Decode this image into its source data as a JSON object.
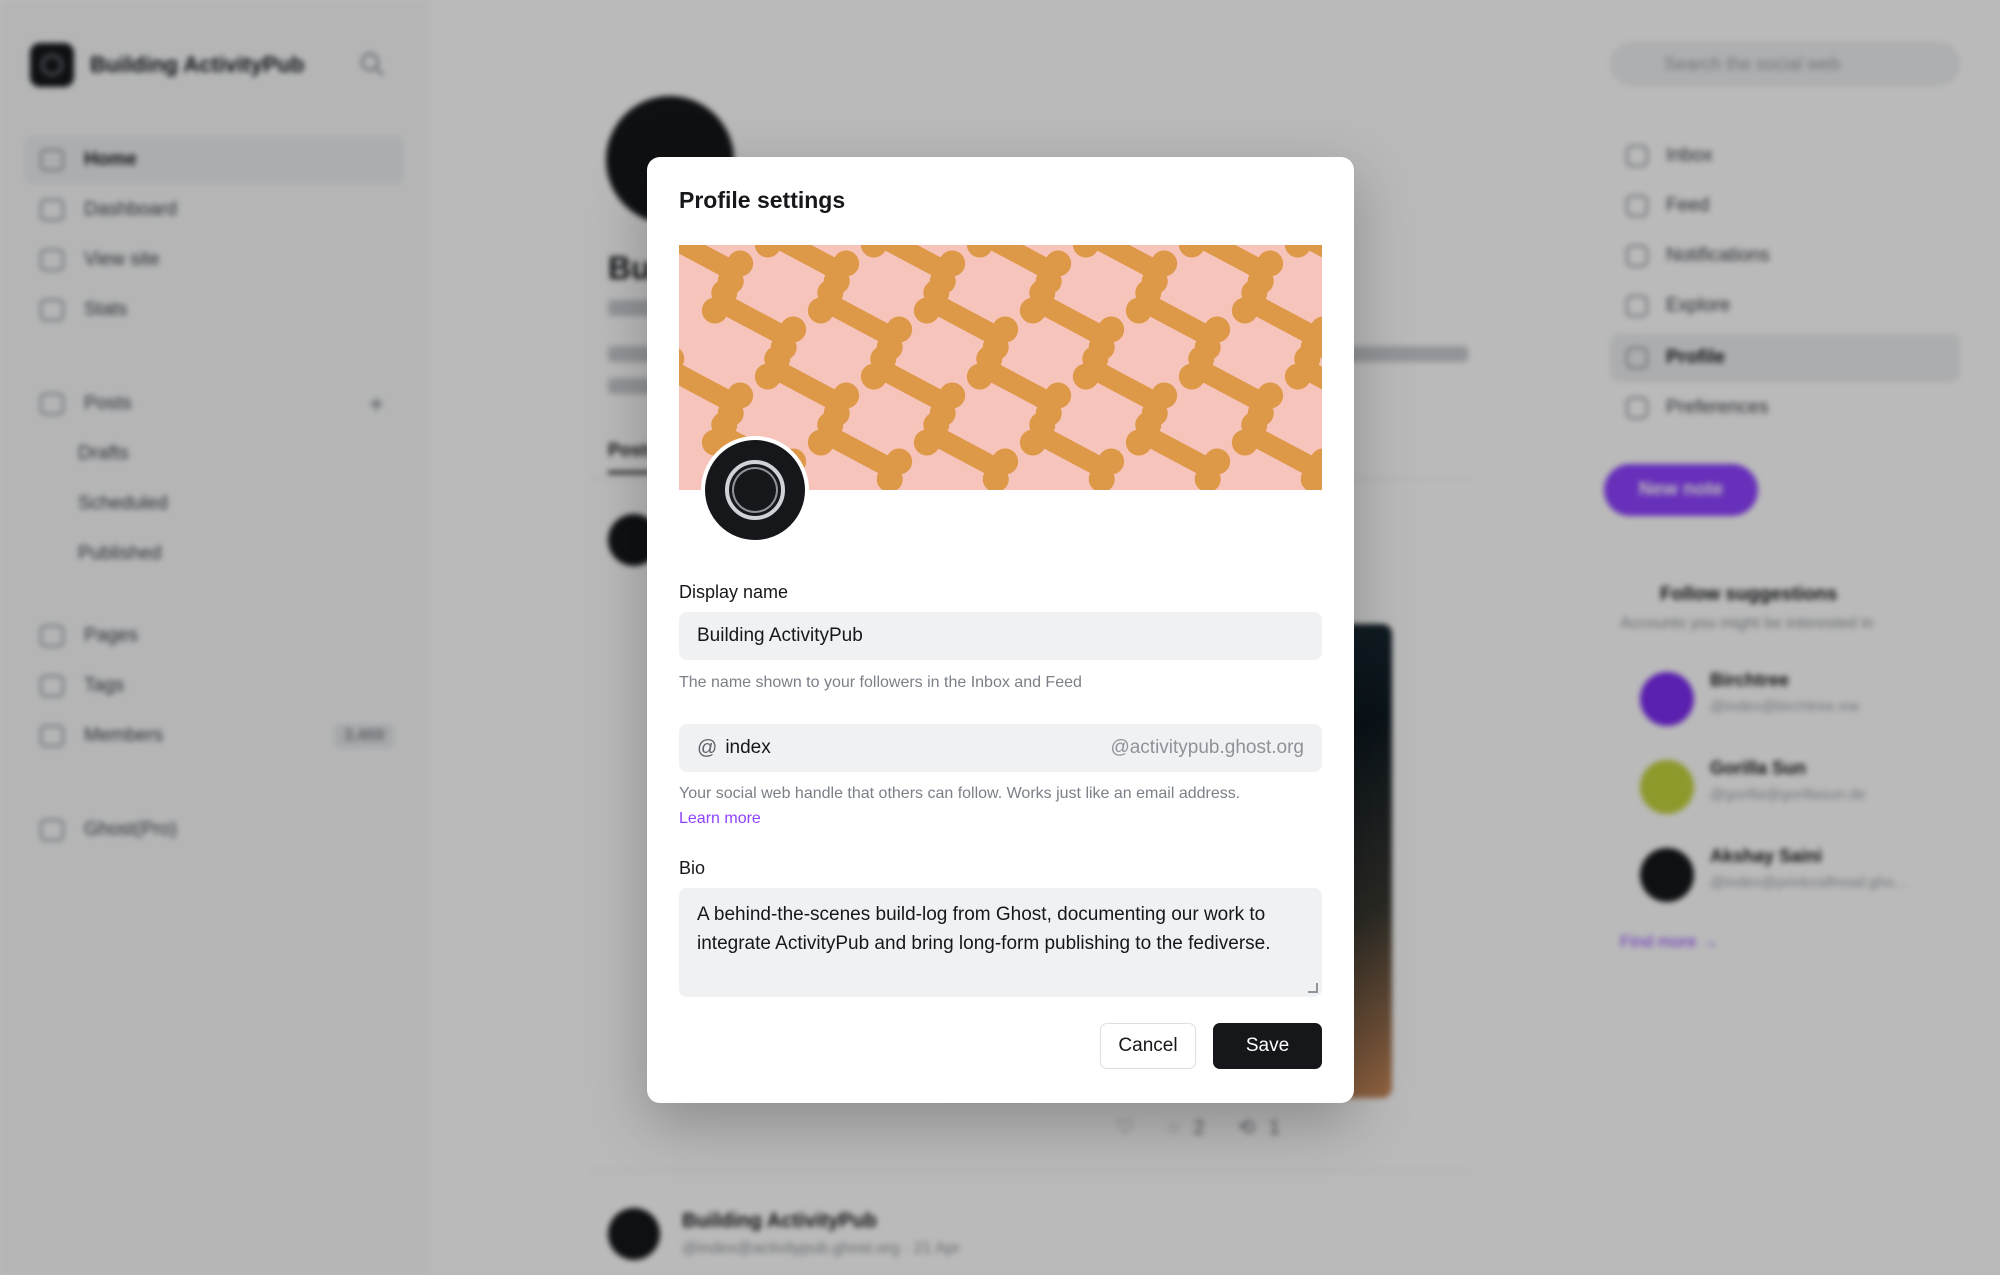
{
  "background": {
    "brand": {
      "name": "Building ActivityPub"
    },
    "left_nav": [
      {
        "label": "Home",
        "icon": "home-icon"
      },
      {
        "label": "Dashboard",
        "icon": "dashboard-icon"
      },
      {
        "label": "View site",
        "icon": "view-site-icon"
      },
      {
        "label": "Stats",
        "icon": "stats-icon"
      },
      {
        "label": "Posts",
        "icon": "posts-icon"
      },
      {
        "label": "Drafts"
      },
      {
        "label": "Scheduled"
      },
      {
        "label": "Published"
      },
      {
        "label": "Pages",
        "icon": "pages-icon"
      },
      {
        "label": "Tags",
        "icon": "tags-icon"
      },
      {
        "label": "Members",
        "icon": "members-icon",
        "count": "3,469"
      },
      {
        "label": "Ghost(Pro)",
        "icon": "ghost-pro-icon"
      }
    ],
    "profile": {
      "name": "Building ActivityPub",
      "handle": "@index@activitypub.ghost.org",
      "date": "21 Apr",
      "tab": "Posts",
      "likes": "",
      "replies": "2",
      "reposts": "1"
    },
    "right_nav": {
      "search_placeholder": "Search the social web",
      "items": [
        {
          "label": "Inbox",
          "icon": "inbox-icon"
        },
        {
          "label": "Feed",
          "icon": "feed-icon"
        },
        {
          "label": "Notifications",
          "icon": "bell-icon"
        },
        {
          "label": "Explore",
          "icon": "compass-icon"
        },
        {
          "label": "Profile",
          "icon": "user-icon"
        },
        {
          "label": "Preferences",
          "icon": "preferences-icon"
        }
      ],
      "new_note": "New note"
    },
    "follow_suggestions": {
      "title": "Follow suggestions",
      "subtitle": "Accounts you might be interested in",
      "items": [
        {
          "name": "Birchtree",
          "handle": "@index@birchtree.me",
          "color": "#7c2cf0"
        },
        {
          "name": "Gorilla Sun",
          "handle": "@gorilla@gorillasun.de",
          "color": "#c3d23c"
        },
        {
          "name": "Akshay Saini",
          "handle": "@index@printcraftread.gho...",
          "color": "#15171a"
        }
      ],
      "find_more": "Find more →"
    }
  },
  "modal": {
    "title": "Profile settings",
    "display_name": {
      "label": "Display name",
      "value": "Building ActivityPub",
      "help": "The name shown to your followers in the Inbox and Feed"
    },
    "handle": {
      "at_symbol": "@",
      "value": "index",
      "domain": "@activitypub.ghost.org",
      "help": "Your social web handle that others can follow. Works just like an email address.",
      "learn_more": "Learn more"
    },
    "bio": {
      "label": "Bio",
      "value": "A behind-the-scenes build-log from Ghost, documenting our work to integrate ActivityPub and bring long-form publishing to the fediverse."
    },
    "cancel_label": "Cancel",
    "save_label": "Save"
  },
  "colors": {
    "accent": "#8e42ff",
    "primary_button": "#15171a",
    "cover_background": "#f7c4bc",
    "cover_bone": "#dd9848"
  }
}
